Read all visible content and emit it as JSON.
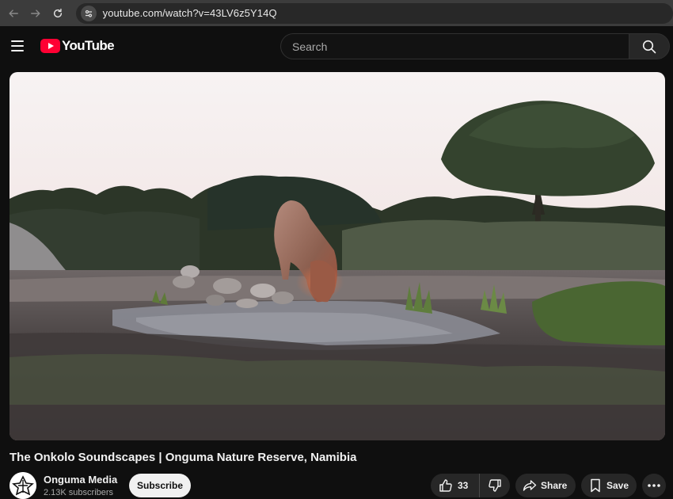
{
  "browser": {
    "url": "youtube.com/watch?v=43LV6z5Y14Q",
    "icons": {
      "back": "back-arrow-icon",
      "forward": "forward-arrow-icon",
      "reload": "reload-icon",
      "site_info": "site-info-icon"
    }
  },
  "header": {
    "logo_text": "YouTube",
    "search_placeholder": "Search",
    "icons": {
      "menu": "hamburger-menu-icon",
      "search": "search-icon",
      "logo": "youtube-play-logo-icon"
    },
    "colors": {
      "brand": "#ff0033"
    }
  },
  "video": {
    "title": "The Onkolo Soundscapes | Onguma Nature Reserve, Namibia",
    "channel": {
      "name": "Onguma Media",
      "subscribers": "2.13K subscribers",
      "subscribe_label": "Subscribe"
    },
    "actions": {
      "like_count": "33",
      "share_label": "Share",
      "save_label": "Save"
    }
  }
}
